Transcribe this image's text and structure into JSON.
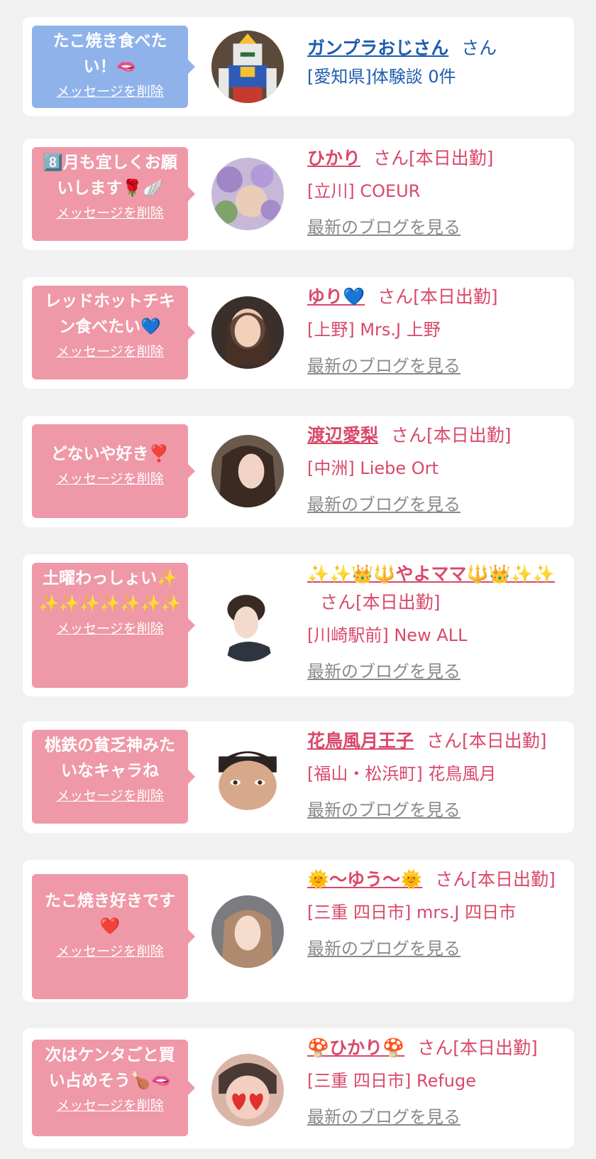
{
  "colors": {
    "blue": "#8fb2ea",
    "pink": "#ef98a8",
    "text_pink": "#d9486a",
    "text_blue": "#1e5cae",
    "grey": "#8a8a8a"
  },
  "delete_label": "メッセージを削除",
  "blog_label": "最新のブログを見る",
  "cards": [
    {
      "message": "たこ焼き食べたい！🫦",
      "name": "ガンプラおじさん",
      "suffix": "さん",
      "shop": "[愛知県]体験談 0件",
      "theme": "blue",
      "avatar_icon": "gundam-figure-icon"
    },
    {
      "message": "8️⃣月も宜しくお願いします🌹🪽",
      "name": "ひかり",
      "suffix": "さん[本日出勤]",
      "shop": "[立川] COEUR",
      "theme": "pink",
      "avatar_icon": "flowers-photo-icon"
    },
    {
      "message": "レッドホットチキン食べたい💙",
      "name": "ゆり💙",
      "suffix": "さん[本日出勤]",
      "shop": "[上野] Mrs.J 上野",
      "theme": "pink",
      "avatar_icon": "woman-photo-icon"
    },
    {
      "message": "どないや好き❣️",
      "name": "渡辺愛梨",
      "suffix": "さん[本日出勤]",
      "shop": "[中洲] Liebe Ort",
      "theme": "pink",
      "avatar_icon": "woman-photo-icon"
    },
    {
      "message": "土曜わっしょい✨✨✨✨✨✨✨✨",
      "name": "✨✨👑🔱やよママ🔱👑✨✨",
      "suffix": "さん[本日出勤]",
      "shop": "[川崎駅前] New ALL",
      "theme": "pink",
      "avatar_icon": "woman-photo-icon"
    },
    {
      "message": "桃鉄の貧乏神みたいなキャラね",
      "name": "花鳥風月王子",
      "suffix": "さん[本日出勤]",
      "shop": "[福山・松浜町] 花鳥風月",
      "theme": "pink",
      "avatar_icon": "man-face-icon"
    },
    {
      "message": "たこ焼き好きです❤️",
      "name": "🌞〜ゆう〜🌞",
      "suffix": "さん[本日出勤]",
      "shop": "[三重 四日市] mrs.J 四日市",
      "theme": "pink",
      "avatar_icon": "woman-photo-icon"
    },
    {
      "message": "次はケンタごと買い占めそう🍗🫦",
      "name": "🍄ひかり🍄",
      "suffix": "さん[本日出勤]",
      "shop": "[三重 四日市] Refuge",
      "theme": "pink",
      "avatar_icon": "woman-photo-icon"
    }
  ]
}
